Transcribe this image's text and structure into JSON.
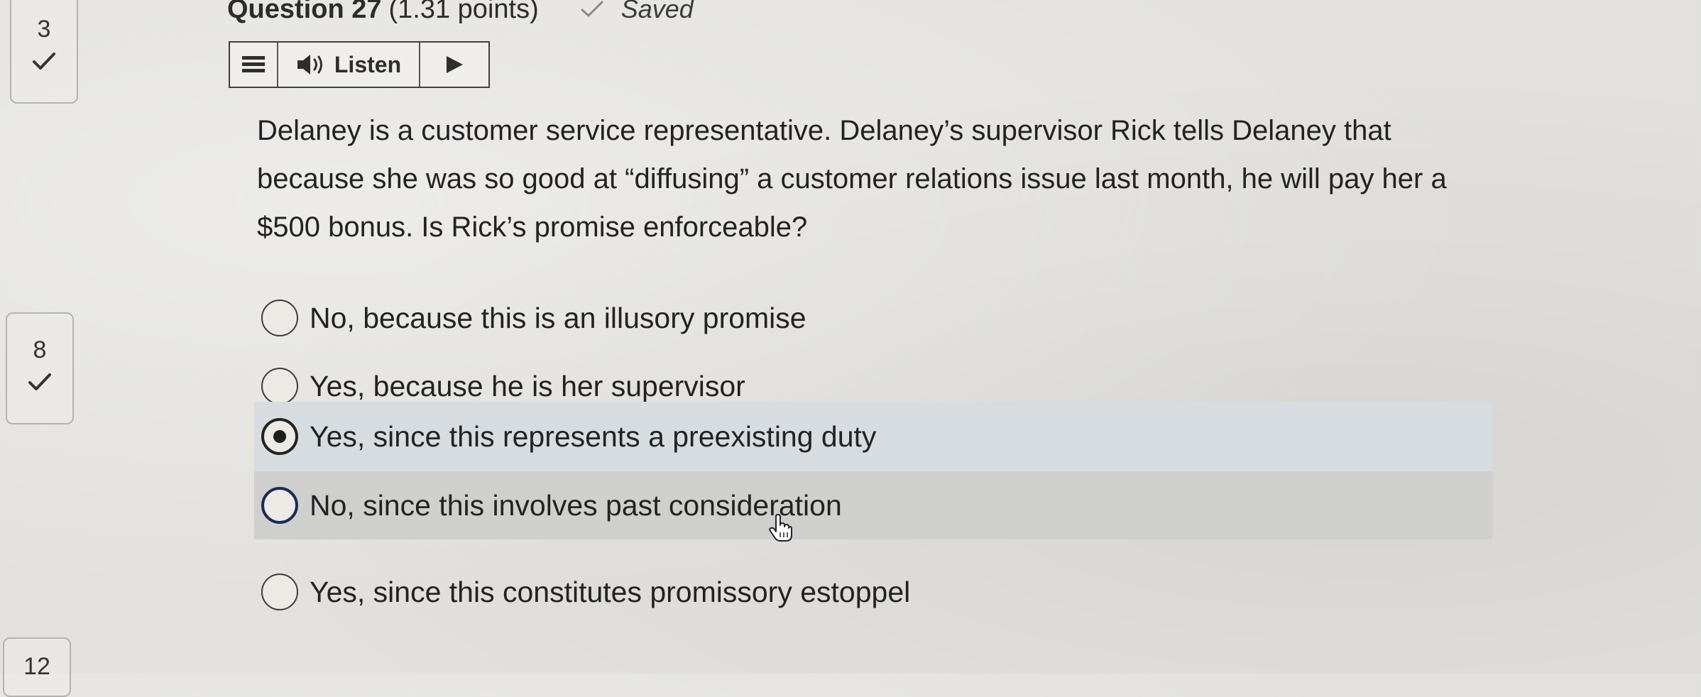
{
  "nav": {
    "items": [
      {
        "number": "3",
        "status": "answered"
      },
      {
        "number": "8",
        "status": "answered"
      },
      {
        "number": "12",
        "status": "partially-visible"
      }
    ]
  },
  "question": {
    "title": "Question 27",
    "points": "(1.31 points)",
    "saved_label": "Saved",
    "body": "Delaney is a customer service representative. Delaney’s supervisor Rick tells Delaney that because she was so good at “diffusing” a customer relations issue last month, he will pay her a $500 bonus. Is Rick’s promise enforceable?"
  },
  "toolbar": {
    "menu_icon": "menu-icon",
    "speaker_icon": "speaker-icon",
    "listen_label": "Listen",
    "play_icon": "play-icon"
  },
  "options": [
    {
      "label": "No, because this is an illusory promise",
      "selected": false
    },
    {
      "label": "Yes, because he is her supervisor",
      "selected": false
    },
    {
      "label": "Yes, since this represents a preexisting duty",
      "selected": true
    },
    {
      "label": "No, since this involves past consideration",
      "selected": false,
      "hovered": true
    },
    {
      "label": "Yes, since this constitutes promissory estoppel",
      "selected": false
    }
  ],
  "colors": {
    "background": "#e2e1dd",
    "selected_row": "#d7dce0",
    "hover_row": "#cfd0ce",
    "focus_ring": "#1c2a55"
  }
}
